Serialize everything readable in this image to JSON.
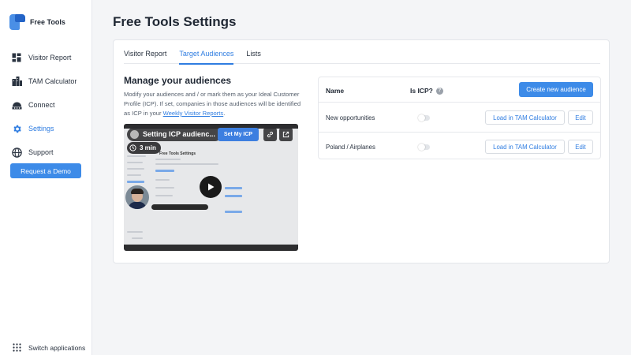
{
  "brand": {
    "name": "Free Tools",
    "colors": {
      "light": "#4a8fe6",
      "dark": "#2364c7"
    }
  },
  "sidebar": {
    "items": [
      {
        "label": "Visitor Report",
        "icon": "dashboard-icon",
        "active": false
      },
      {
        "label": "TAM Calculator",
        "icon": "buildings-icon",
        "active": false
      },
      {
        "label": "Connect",
        "icon": "connect-icon",
        "active": false
      },
      {
        "label": "Settings",
        "icon": "gear-icon",
        "active": true
      },
      {
        "label": "Support",
        "icon": "globe-icon",
        "active": false
      }
    ],
    "demo_button": "Request a Demo",
    "switch_apps": "Switch applications"
  },
  "page": {
    "title": "Free Tools Settings"
  },
  "tabs": [
    {
      "label": "Visitor Report",
      "active": false
    },
    {
      "label": "Target Audiences",
      "active": true
    },
    {
      "label": "Lists",
      "active": false
    }
  ],
  "manage": {
    "title": "Manage your audiences",
    "description": "Modify your audiences and / or mark them as your Ideal Customer Profile (ICP). If set, companies in those audiences will be identified as ICP in your ",
    "link_text": "Weekly Visitor Reports",
    "description_end": "."
  },
  "video": {
    "title": "Setting ICP audienc...",
    "cta": "Set My ICP",
    "duration": "3 min",
    "preview_title": "Free Tools Settings"
  },
  "audiences": {
    "col_name": "Name",
    "col_icp": "Is ICP?",
    "info_glyph": "?",
    "create_button": "Create new audience",
    "load_label": "Load in TAM Calculator",
    "edit_label": "Edit",
    "rows": [
      {
        "name": "New opportunities",
        "is_icp": false
      },
      {
        "name": "Poland / Airplanes",
        "is_icp": false
      }
    ]
  },
  "colors": {
    "accent": "#2f7de1",
    "button": "#3d8be8"
  }
}
